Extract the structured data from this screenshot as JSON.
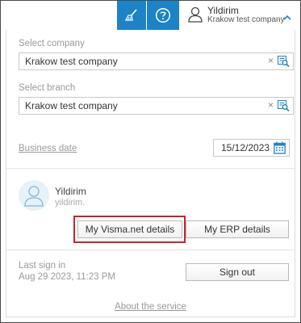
{
  "header": {
    "user_name": "Yildirim",
    "user_company": "Krakow test company",
    "icons": [
      "broom-icon",
      "help-icon",
      "user-icon",
      "chevron-up-icon"
    ],
    "accent_color": "#1c83c6"
  },
  "company": {
    "label": "Select company",
    "value": "Krakow test company",
    "clear": "×"
  },
  "branch": {
    "label": "Select branch",
    "value": "Krakow test company",
    "clear": "×"
  },
  "business_date": {
    "label": "Business date",
    "value": "15/12/2023"
  },
  "profile": {
    "name": "Yildirim",
    "id": "yildirim."
  },
  "buttons": {
    "visma_details": "My Visma.net details",
    "erp_details": "My ERP details",
    "sign_out": "Sign out"
  },
  "last_sign_in": {
    "label": "Last sign in",
    "value": "Aug 29 2023, 11:23 PM"
  },
  "footer": {
    "about": "About the service"
  },
  "highlight_color": "#c8242b"
}
